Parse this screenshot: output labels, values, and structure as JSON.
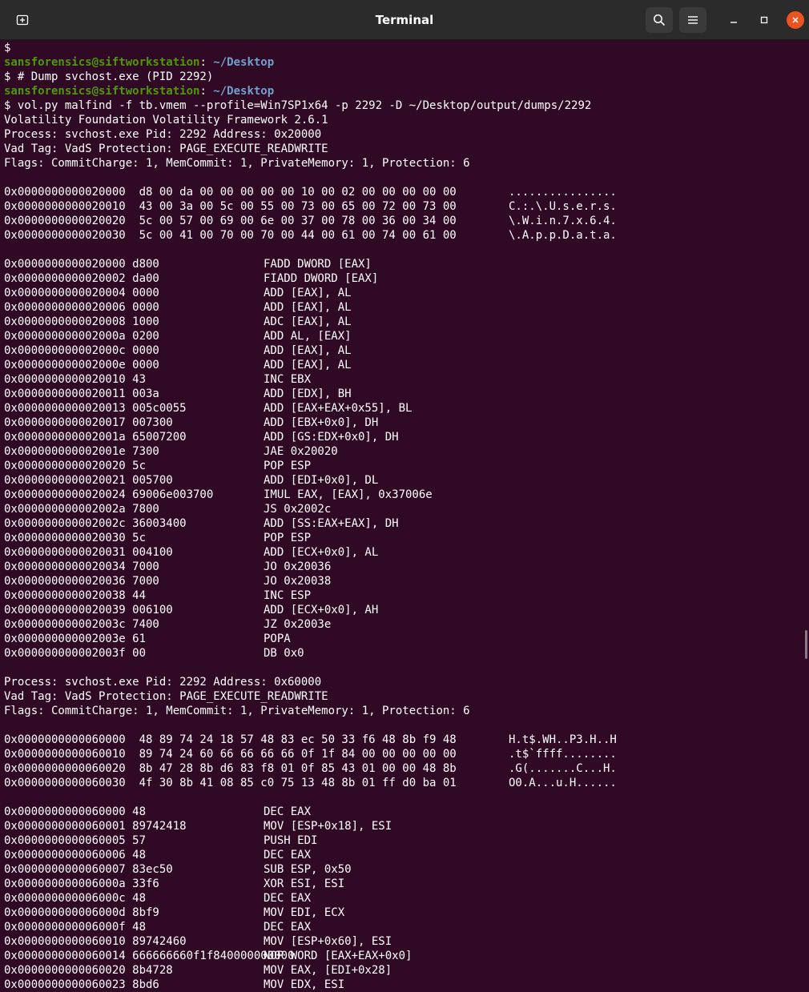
{
  "window": {
    "title": "Terminal",
    "icons": {
      "new_tab": "new-tab-icon",
      "search": "search-icon",
      "menu": "hamburger-menu-icon",
      "minimize": "minimize-icon",
      "maximize": "maximize-icon",
      "close": "close-icon"
    },
    "colors": {
      "background": "#300a24",
      "user": "#4e9a06",
      "path": "#729fcf",
      "close_button": "#e95420"
    }
  },
  "terminal": {
    "lines": [
      {
        "type": "text",
        "text": "$"
      },
      {
        "type": "prompt",
        "user": "sansforensics@siftworkstation",
        "sep": ": ",
        "path": "~/Desktop"
      },
      {
        "type": "text",
        "text": "$ # Dump svchost.exe (PID 2292)"
      },
      {
        "type": "prompt",
        "user": "sansforensics@siftworkstation",
        "sep": ": ",
        "path": "~/Desktop"
      },
      {
        "type": "text",
        "text": "$ vol.py malfind -f tb.vmem --profile=Win7SP1x64 -p 2292 -D ~/Desktop/output/dumps/2292"
      },
      {
        "type": "text",
        "text": "Volatility Foundation Volatility Framework 2.6.1"
      },
      {
        "type": "text",
        "text": "Process: svchost.exe Pid: 2292 Address: 0x20000"
      },
      {
        "type": "text",
        "text": "Vad Tag: VadS Protection: PAGE_EXECUTE_READWRITE"
      },
      {
        "type": "text",
        "text": "Flags: CommitCharge: 1, MemCommit: 1, PrivateMemory: 1, Protection: 6"
      },
      {
        "type": "text",
        "text": ""
      },
      {
        "type": "hex",
        "hex": "0x0000000000020000  d8 00 da 00 00 00 00 00 10 00 02 00 00 00 00 00",
        "ascii": "................"
      },
      {
        "type": "hex",
        "hex": "0x0000000000020010  43 00 3a 00 5c 00 55 00 73 00 65 00 72 00 73 00",
        "ascii": "C.:.\\.U.s.e.r.s."
      },
      {
        "type": "hex",
        "hex": "0x0000000000020020  5c 00 57 00 69 00 6e 00 37 00 78 00 36 00 34 00",
        "ascii": "\\.W.i.n.7.x.6.4."
      },
      {
        "type": "hex",
        "hex": "0x0000000000020030  5c 00 41 00 70 00 70 00 44 00 61 00 74 00 61 00",
        "ascii": "\\.A.p.p.D.a.t.a."
      },
      {
        "type": "text",
        "text": ""
      },
      {
        "type": "asm",
        "addr": "0x0000000000020000 d800",
        "ins": "FADD DWORD [EAX]"
      },
      {
        "type": "asm",
        "addr": "0x0000000000020002 da00",
        "ins": "FIADD DWORD [EAX]"
      },
      {
        "type": "asm",
        "addr": "0x0000000000020004 0000",
        "ins": "ADD [EAX], AL"
      },
      {
        "type": "asm",
        "addr": "0x0000000000020006 0000",
        "ins": "ADD [EAX], AL"
      },
      {
        "type": "asm",
        "addr": "0x0000000000020008 1000",
        "ins": "ADC [EAX], AL"
      },
      {
        "type": "asm",
        "addr": "0x000000000002000a 0200",
        "ins": "ADD AL, [EAX]"
      },
      {
        "type": "asm",
        "addr": "0x000000000002000c 0000",
        "ins": "ADD [EAX], AL"
      },
      {
        "type": "asm",
        "addr": "0x000000000002000e 0000",
        "ins": "ADD [EAX], AL"
      },
      {
        "type": "asm",
        "addr": "0x0000000000020010 43",
        "ins": "INC EBX"
      },
      {
        "type": "asm",
        "addr": "0x0000000000020011 003a",
        "ins": "ADD [EDX], BH"
      },
      {
        "type": "asm",
        "addr": "0x0000000000020013 005c0055",
        "ins": "ADD [EAX+EAX+0x55], BL"
      },
      {
        "type": "asm",
        "addr": "0x0000000000020017 007300",
        "ins": "ADD [EBX+0x0], DH"
      },
      {
        "type": "asm",
        "addr": "0x000000000002001a 65007200",
        "ins": "ADD [GS:EDX+0x0], DH"
      },
      {
        "type": "asm",
        "addr": "0x000000000002001e 7300",
        "ins": "JAE 0x20020"
      },
      {
        "type": "asm",
        "addr": "0x0000000000020020 5c",
        "ins": "POP ESP"
      },
      {
        "type": "asm",
        "addr": "0x0000000000020021 005700",
        "ins": "ADD [EDI+0x0], DL"
      },
      {
        "type": "asm",
        "addr": "0x0000000000020024 69006e003700",
        "ins": "IMUL EAX, [EAX], 0x37006e"
      },
      {
        "type": "asm",
        "addr": "0x000000000002002a 7800",
        "ins": "JS 0x2002c"
      },
      {
        "type": "asm",
        "addr": "0x000000000002002c 36003400",
        "ins": "ADD [SS:EAX+EAX], DH"
      },
      {
        "type": "asm",
        "addr": "0x0000000000020030 5c",
        "ins": "POP ESP"
      },
      {
        "type": "asm",
        "addr": "0x0000000000020031 004100",
        "ins": "ADD [ECX+0x0], AL"
      },
      {
        "type": "asm",
        "addr": "0x0000000000020034 7000",
        "ins": "JO 0x20036"
      },
      {
        "type": "asm",
        "addr": "0x0000000000020036 7000",
        "ins": "JO 0x20038"
      },
      {
        "type": "asm",
        "addr": "0x0000000000020038 44",
        "ins": "INC ESP"
      },
      {
        "type": "asm",
        "addr": "0x0000000000020039 006100",
        "ins": "ADD [ECX+0x0], AH"
      },
      {
        "type": "asm",
        "addr": "0x000000000002003c 7400",
        "ins": "JZ 0x2003e"
      },
      {
        "type": "asm",
        "addr": "0x000000000002003e 61",
        "ins": "POPA"
      },
      {
        "type": "asm",
        "addr": "0x000000000002003f 00",
        "ins": "DB 0x0"
      },
      {
        "type": "text",
        "text": ""
      },
      {
        "type": "text",
        "text": "Process: svchost.exe Pid: 2292 Address: 0x60000"
      },
      {
        "type": "text",
        "text": "Vad Tag: VadS Protection: PAGE_EXECUTE_READWRITE"
      },
      {
        "type": "text",
        "text": "Flags: CommitCharge: 1, MemCommit: 1, PrivateMemory: 1, Protection: 6"
      },
      {
        "type": "text",
        "text": ""
      },
      {
        "type": "hex",
        "hex": "0x0000000000060000  48 89 74 24 18 57 48 83 ec 50 33 f6 48 8b f9 48",
        "ascii": "H.t$.WH..P3.H..H"
      },
      {
        "type": "hex",
        "hex": "0x0000000000060010  89 74 24 60 66 66 66 66 0f 1f 84 00 00 00 00 00",
        "ascii": ".t$`ffff........"
      },
      {
        "type": "hex",
        "hex": "0x0000000000060020  8b 47 28 8b d6 83 f8 01 0f 85 43 01 00 00 48 8b",
        "ascii": ".G(.......C...H."
      },
      {
        "type": "hex",
        "hex": "0x0000000000060030  4f 30 8b 41 08 85 c0 75 13 48 8b 01 ff d0 ba 01",
        "ascii": "O0.A...u.H......"
      },
      {
        "type": "text",
        "text": ""
      },
      {
        "type": "asm",
        "addr": "0x0000000000060000 48",
        "ins": "DEC EAX"
      },
      {
        "type": "asm",
        "addr": "0x0000000000060001 89742418",
        "ins": "MOV [ESP+0x18], ESI"
      },
      {
        "type": "asm",
        "addr": "0x0000000000060005 57",
        "ins": "PUSH EDI"
      },
      {
        "type": "asm",
        "addr": "0x0000000000060006 48",
        "ins": "DEC EAX"
      },
      {
        "type": "asm",
        "addr": "0x0000000000060007 83ec50",
        "ins": "SUB ESP, 0x50"
      },
      {
        "type": "asm",
        "addr": "0x000000000006000a 33f6",
        "ins": "XOR ESI, ESI"
      },
      {
        "type": "asm",
        "addr": "0x000000000006000c 48",
        "ins": "DEC EAX"
      },
      {
        "type": "asm",
        "addr": "0x000000000006000d 8bf9",
        "ins": "MOV EDI, ECX"
      },
      {
        "type": "asm",
        "addr": "0x000000000006000f 48",
        "ins": "DEC EAX"
      },
      {
        "type": "asm",
        "addr": "0x0000000000060010 89742460",
        "ins": "MOV [ESP+0x60], ESI"
      },
      {
        "type": "asm",
        "addr": "0x0000000000060014 666666660f1f840000000000",
        "ins": "NOP WORD [EAX+EAX+0x0]"
      },
      {
        "type": "asm",
        "addr": "0x0000000000060020 8b4728",
        "ins": "MOV EAX, [EDI+0x28]"
      },
      {
        "type": "asm",
        "addr": "0x0000000000060023 8bd6",
        "ins": "MOV EDX, ESI"
      }
    ]
  }
}
